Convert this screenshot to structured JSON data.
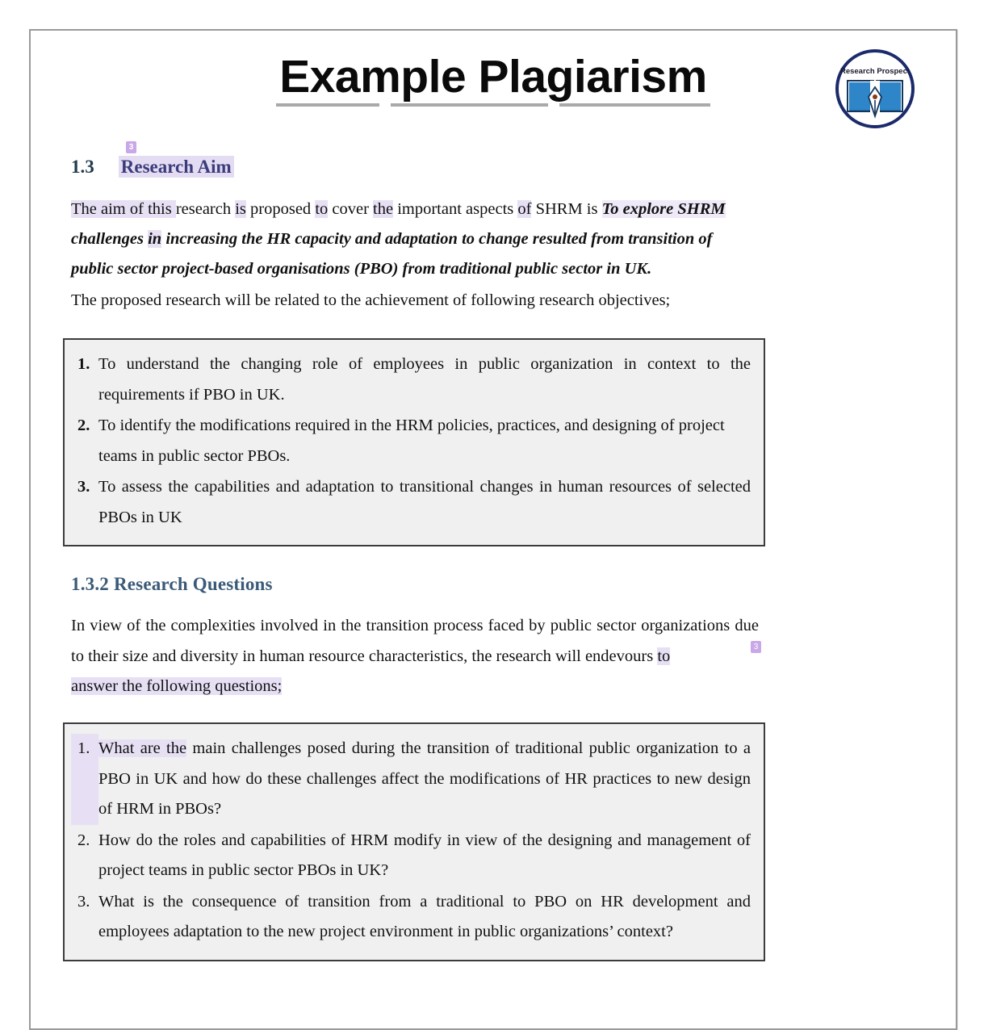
{
  "document": {
    "title": "Example Plagiarism",
    "logo": {
      "brand": "Research Prospect",
      "icon": "open-book-with-pen-nib-icon",
      "ring_color": "#1b2a6b"
    }
  },
  "sections": {
    "research_aim": {
      "number": "1.3",
      "heading": "Research Aim",
      "badge": "3",
      "paragraph_parts": [
        {
          "text": "The aim of this ",
          "highlight": true
        },
        {
          "text": "research ",
          "highlight": false
        },
        {
          "text": "is",
          "highlight": true
        },
        {
          "text": " proposed ",
          "highlight": false
        },
        {
          "text": "to",
          "highlight": true
        },
        {
          "text": " cover ",
          "highlight": false
        },
        {
          "text": "the",
          "highlight": true
        },
        {
          "text": " important aspects ",
          "highlight": false
        },
        {
          "text": "of",
          "highlight": true
        },
        {
          "text": " SHRM is ",
          "highlight": false
        }
      ],
      "aim_statement_1": "To explore SHRM",
      "aim_statement_2a": "challenges ",
      "aim_statement_2b": "in",
      "aim_statement_2c": " increasing the HR capacity and adaptation to change resulted from transition of",
      "aim_statement_3": "public sector project-based organisations (PBO) from traditional public sector in UK.",
      "objectives_intro": "The proposed research will be related to the achievement of following research objectives;"
    },
    "objectives_box": {
      "items": [
        {
          "number": "1.",
          "text": "To understand the changing role of employees in public organization in context to the requirements if PBO in UK."
        },
        {
          "number": "2.",
          "text": "To identify the modifications required in the HRM policies, practices, and designing of project teams in public sector PBOs."
        },
        {
          "number": "3.",
          "text": "To assess the capabilities and adaptation  to transitional changes  in  human resources of selected PBOs in UK"
        }
      ]
    },
    "research_questions": {
      "heading": "1.3.2 Research Questions",
      "badge": "3",
      "intro_part_1": "In view of the complexities involved in the transition process faced by public sector organizations due to their size and diversity in human resource characteristics, the research will endevours ",
      "intro_part_2": "to",
      "intro_part_3": "answer the following questions;"
    },
    "questions_box": {
      "items": [
        {
          "number": "1.",
          "highlighted_lead": "What are the",
          "text": " main challenges posed during the transition of traditional public organization to a PBO in UK and how do these challenges affect the modifications of HR practices to new design of HRM in PBOs?",
          "number_highlighted": true
        },
        {
          "number": "2.",
          "highlighted_lead": "",
          "text": "How do the roles and capabilities of HRM modify in view of the designing and management of project teams in public sector PBOs in UK?",
          "number_highlighted": false
        },
        {
          "number": "3.",
          "highlighted_lead": "",
          "text": "What is the consequence of transition from a traditional to PBO on HR development and employees adaptation to the new project environment in public organizations’ context?",
          "number_highlighted": false
        }
      ]
    }
  },
  "colors": {
    "highlight": "#e7e0f5",
    "badge": "#c9a8e8",
    "heading_aim": "#3b3c7a",
    "heading_questions": "#3a5a78",
    "box_border": "#3c3c3c",
    "box_fill": "#f0f0f0",
    "page_border": "#9a9a9a"
  }
}
